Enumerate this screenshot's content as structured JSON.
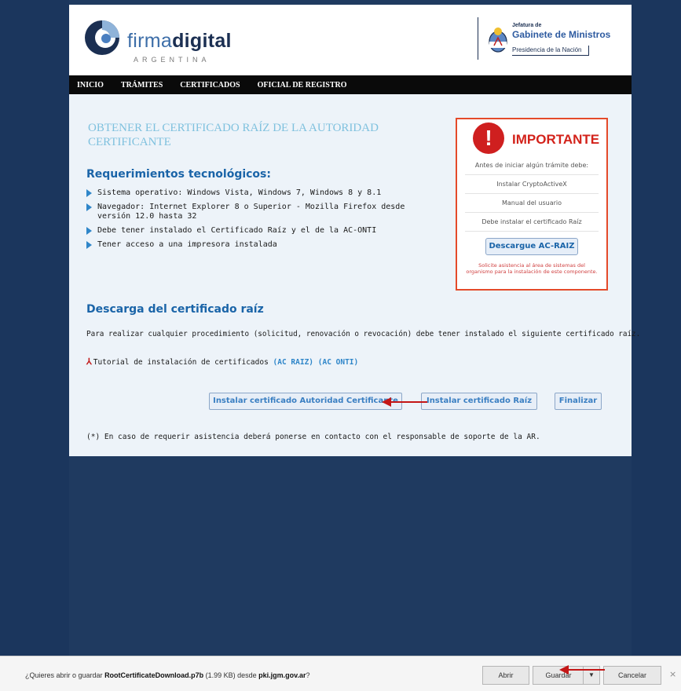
{
  "header": {
    "logo_light": "firma",
    "logo_bold": "digital",
    "logo_sub": "ARGENTINA",
    "gov_small": "Jefatura de",
    "gov_big": "Gabinete de Ministros",
    "gov_line": "Presidencia de la Nación"
  },
  "nav": {
    "items": [
      "INICIO",
      "TRÁMITES",
      "CERTIFICADOS",
      "OFICIAL DE REGISTRO"
    ]
  },
  "main": {
    "title": "OBTENER EL CERTIFICADO RAÍZ DE LA AUTORIDAD CERTIFICANTE",
    "req_heading": "Requerimientos tecnológicos:",
    "requirements": [
      "Sistema operativo: Windows Vista, Windows 7, Windows 8 y 8.1",
      "Navegador: Internet Explorer 8 o Superior - Mozilla Firefox desde versión 12.0 hasta 32",
      "Debe tener instalado el Certificado Raíz y el de la AC-ONTI",
      "Tener acceso a una impresora instalada"
    ],
    "download_heading": "Descarga del certificado raíz",
    "download_text": "Para realizar cualquier procedimiento (solicitud, renovación o revocación) debe tener instalado el siguiente certificado raíz.",
    "tutorial_text": "Tutorial de instalación de certificados",
    "tutorial_link1": "(AC RAIZ)",
    "tutorial_link2": "(AC ONTI)",
    "btn_install_ac": "Instalar certificado Autoridad Certificante",
    "btn_install_root": "Instalar certificado Raíz",
    "btn_finish": "Finalizar",
    "note": "(*) En caso de requerir asistencia deberá ponerse en contacto con el responsable de soporte de la AR."
  },
  "important": {
    "icon": "!",
    "title": "IMPORTANTE",
    "intro": "Antes de iniciar algún trámite debe:",
    "item1": "Instalar CryptoActiveX",
    "item2": "Manual del usuario",
    "item3": "Debe instalar el certificado Raíz",
    "button": "Descargue AC-RAIZ",
    "note": "Solicite asistencia al área de sistemas del organismo para la instalación de este componente."
  },
  "download_bar": {
    "prefix": "¿Quieres abrir o guardar",
    "filename": "RootCertificateDownload.p7b",
    "size": "(1.99 KB) desde",
    "domain": "pki.jgm.gov.ar",
    "suffix": "?",
    "open": "Abrir",
    "save": "Guardar",
    "dropdown": "▼",
    "cancel": "Cancelar",
    "close": "×"
  },
  "colors": {
    "background_blue": "#1f3a60",
    "accent_blue": "#1a64a8",
    "important_red": "#d3221a",
    "arrow_red": "#c41616"
  }
}
